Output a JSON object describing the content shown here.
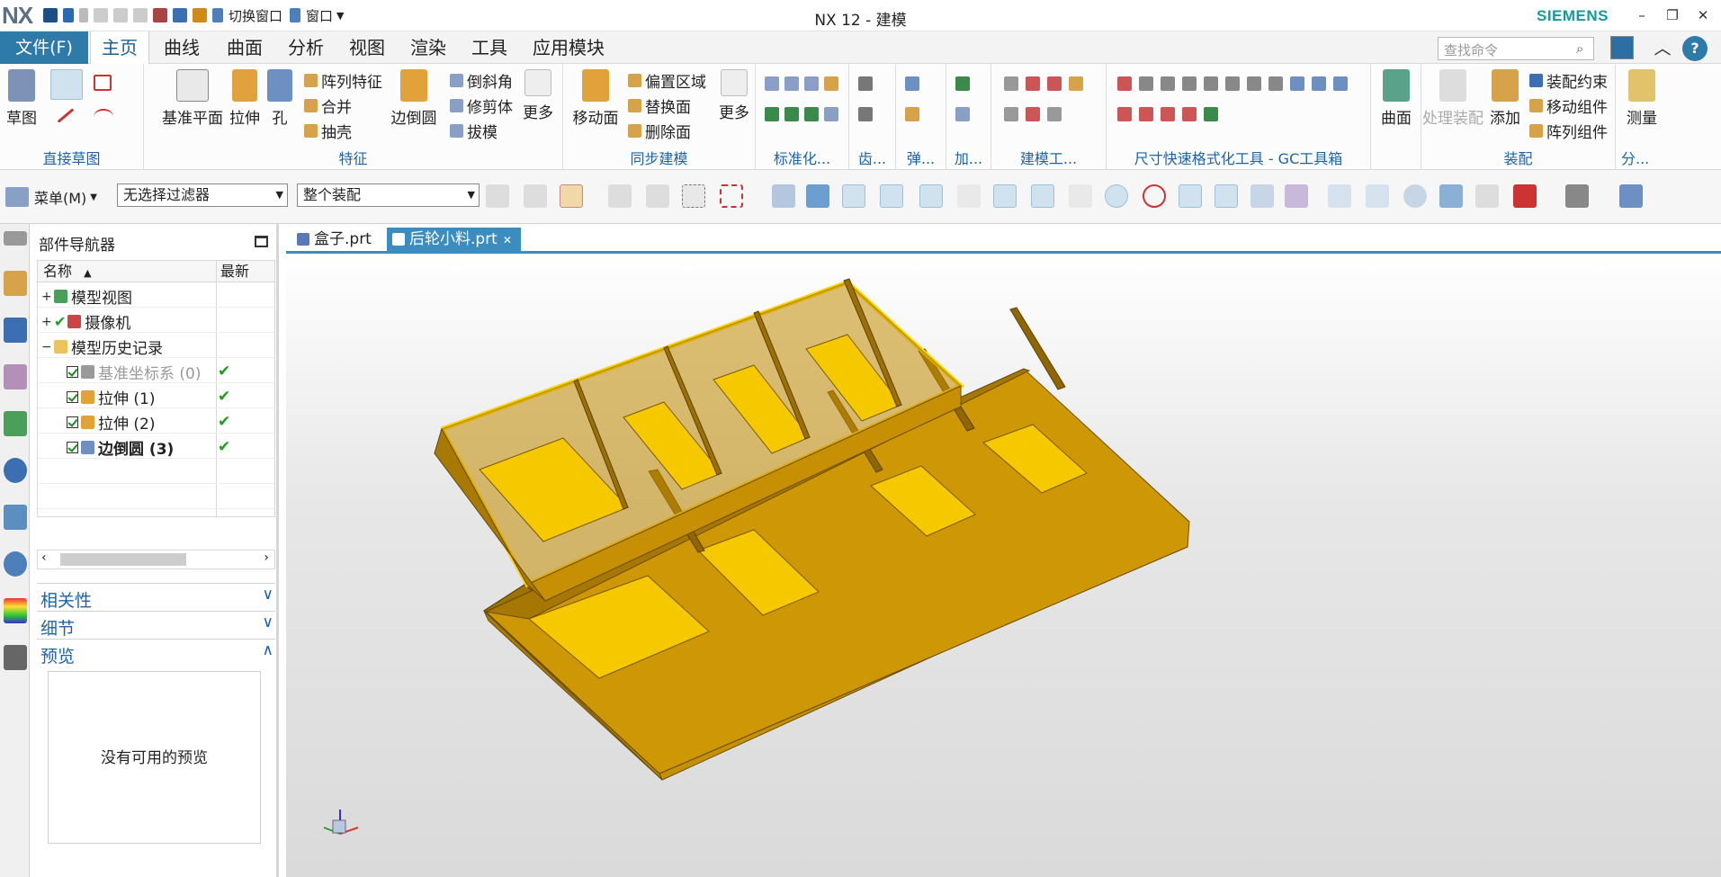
{
  "app": {
    "logo": "NX",
    "title": "NX 12 - 建模",
    "brand": "SIEMENS",
    "quick_access": {
      "switch_window": "切换窗口",
      "window": "窗口"
    }
  },
  "menubar": {
    "file": "文件(F)",
    "tabs": [
      "主页",
      "曲线",
      "曲面",
      "分析",
      "视图",
      "渲染",
      "工具",
      "应用模块"
    ],
    "search_placeholder": "查找命令"
  },
  "ribbon": {
    "direct_sketch": {
      "label": "直接草图",
      "sketch": "草图"
    },
    "feature": {
      "label": "特征",
      "datum_plane": "基准平面",
      "extrude": "拉伸",
      "hole": "孔",
      "pattern_feature": "阵列特征",
      "unite": "合并",
      "shell": "抽壳",
      "edge_blend": "边倒圆",
      "chamfer": "倒斜角",
      "trim_body": "修剪体",
      "draft": "拔模",
      "more": "更多"
    },
    "sync_modeling": {
      "label": "同步建模",
      "move_face": "移动面",
      "offset_region": "偏置区域",
      "replace_face": "替换面",
      "delete_face": "删除面",
      "more": "更多"
    },
    "standard": {
      "label": "标准化..."
    },
    "gear": {
      "label": "齿..."
    },
    "spring": {
      "label": "弹..."
    },
    "add": {
      "label": "加..."
    },
    "modeling_tools": {
      "label": "建模工..."
    },
    "dimension_tools": {
      "label": "尺寸快速格式化工具 - GC工具箱"
    },
    "surface": {
      "label": "曲面"
    },
    "assembly": {
      "label": "装配",
      "process_assembly": "处理装配",
      "add": "添加",
      "constraints": "装配约束",
      "move_component": "移动组件",
      "pattern_component": "阵列组件"
    },
    "measure": {
      "label": "测量",
      "group": "分..."
    }
  },
  "toolbar2": {
    "menu": "菜单(M)",
    "filter": "无选择过滤器",
    "scope": "整个装配"
  },
  "navigator": {
    "title": "部件导航器",
    "col_name": "名称",
    "col_latest": "最新",
    "rows": [
      {
        "name": "模型视图",
        "expand": "+"
      },
      {
        "name": "摄像机",
        "expand": "+"
      },
      {
        "name": "模型历史记录",
        "expand": "−"
      },
      {
        "name": "基准坐标系 (0)",
        "latest": "✔"
      },
      {
        "name": "拉伸 (1)",
        "latest": "✔"
      },
      {
        "name": "拉伸 (2)",
        "latest": "✔"
      },
      {
        "name": "边倒圆 (3)",
        "latest": "✔"
      }
    ],
    "sections": {
      "dependencies": "相关性",
      "details": "细节",
      "preview": "预览"
    },
    "no_preview": "没有可用的预览"
  },
  "documents": {
    "tabs": [
      "盒子.prt",
      "后轮小料.prt"
    ]
  },
  "colors": {
    "accent": "#2e7aa8",
    "tab_active": "#3c8dbf",
    "model_face": "#d29a06",
    "model_bright": "#f5c400"
  }
}
